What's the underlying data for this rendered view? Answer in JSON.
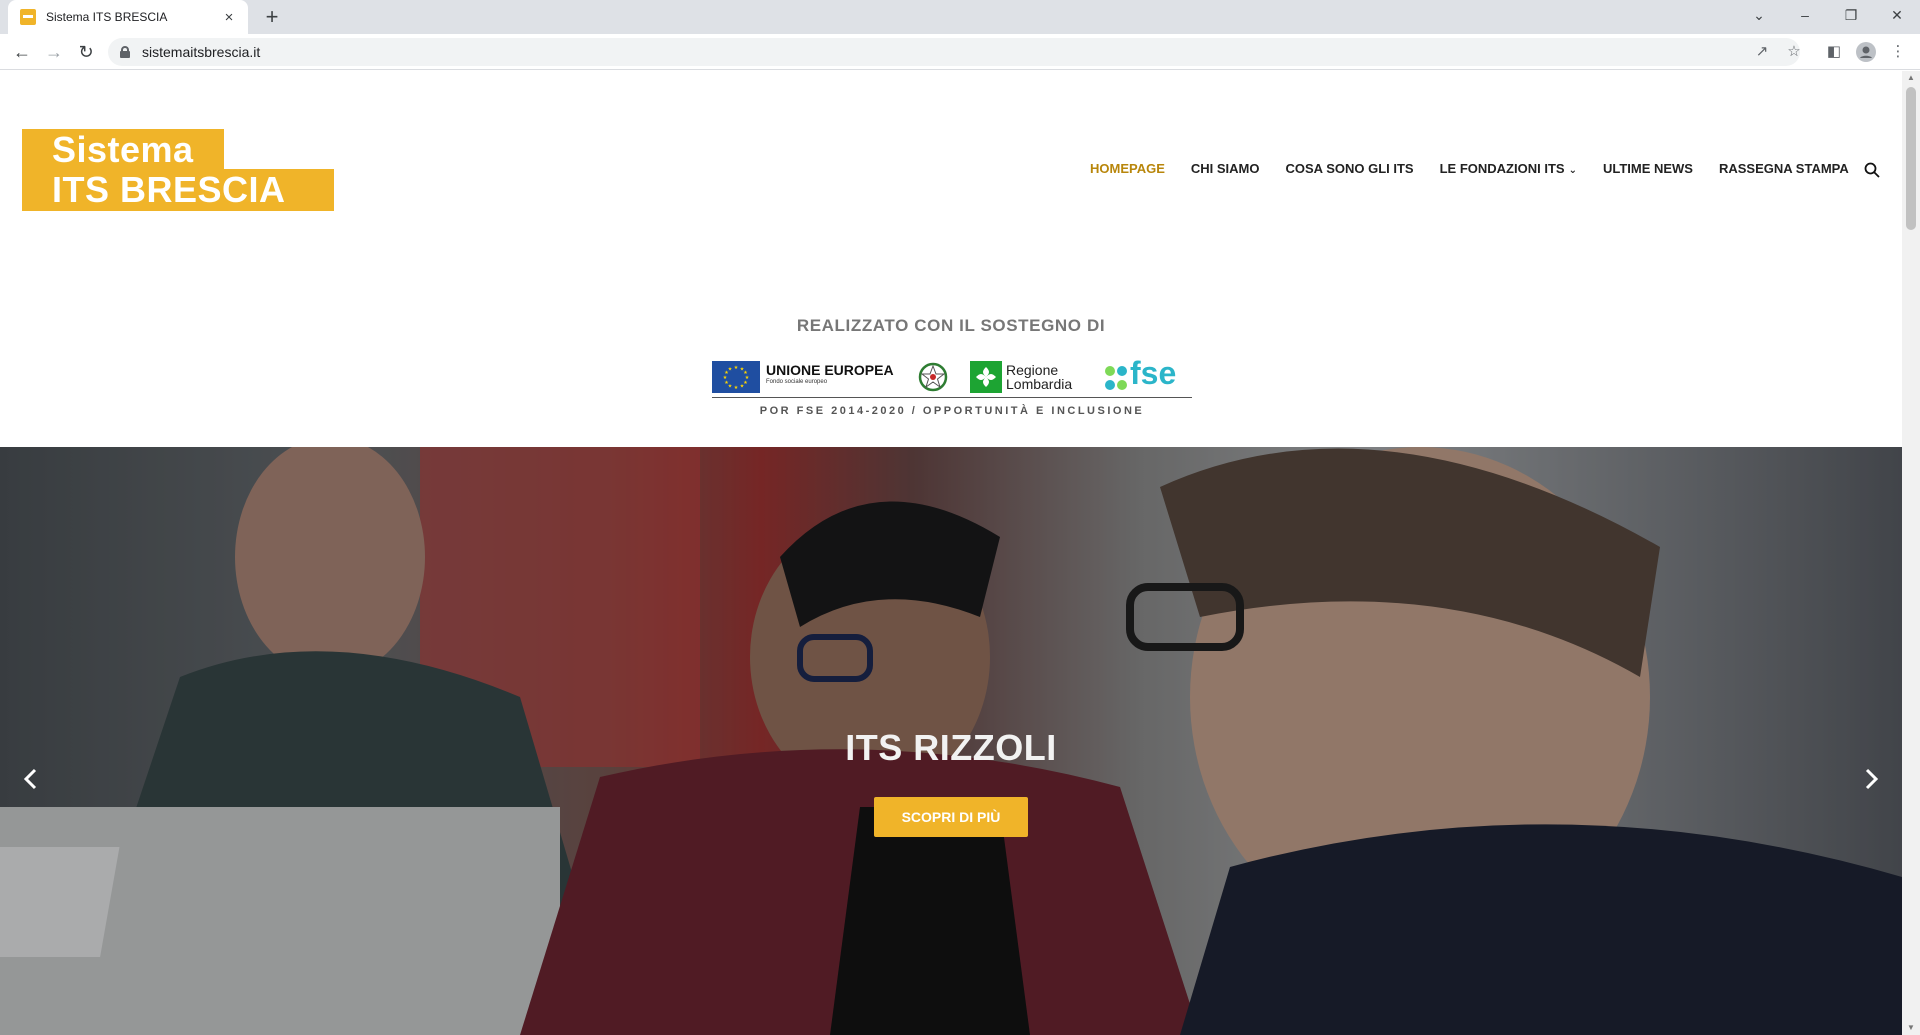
{
  "browser": {
    "tab_title": "Sistema ITS BRESCIA",
    "tab_close": "×",
    "new_tab": "+",
    "url": "sistemaitsbrescia.it"
  },
  "header": {
    "logo_line1": "Sistema",
    "logo_line2": "ITS BRESCIA",
    "nav": [
      "HOMEPAGE",
      "CHI SIAMO",
      "COSA SONO GLI ITS",
      "LE FONDAZIONI ITS",
      "ULTIME NEWS",
      "RASSEGNA STAMPA"
    ],
    "active_nav": "HOMEPAGE"
  },
  "sostegno": {
    "heading": "REALIZZATO CON IL SOSTEGNO DI",
    "eu_title": "UNIONE EUROPEA",
    "eu_subtitle": "Fondo sociale europeo",
    "region_line1": "Regione",
    "region_line2": "Lombardia",
    "fse_label": "fse",
    "caption": "POR FSE 2014-2020 / OPPORTUNITÀ E INCLUSIONE"
  },
  "hero": {
    "title": "ITS RIZZOLI",
    "button": "SCOPRI DI PIÙ"
  },
  "colors": {
    "brand": "#f0b429",
    "active_nav": "#b8860b",
    "eu_blue": "#1f4ea1",
    "lombardia_green": "#1da433",
    "fse_teal": "#2bb5c9"
  },
  "icons": [
    "favicon",
    "close-icon",
    "plus-icon",
    "back-icon",
    "forward-icon",
    "reload-icon",
    "lock-icon",
    "share-icon",
    "star-icon",
    "sidepanel-icon",
    "profile-icon",
    "menu-icon",
    "search-icon",
    "chevron-down-icon",
    "chevron-left-icon",
    "chevron-right-icon"
  ]
}
